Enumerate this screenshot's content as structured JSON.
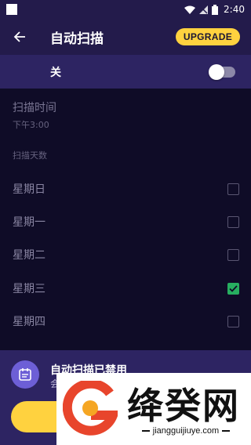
{
  "status": {
    "time": "2:40"
  },
  "header": {
    "title": "自动扫描",
    "upgrade_label": "UPGRADE"
  },
  "toggle": {
    "label": "关",
    "on": false
  },
  "scan_time": {
    "title": "扫描时间",
    "value": "下午3:00"
  },
  "days_section": {
    "label": "扫描天数",
    "days": [
      {
        "label": "星期日",
        "checked": false
      },
      {
        "label": "星期一",
        "checked": false
      },
      {
        "label": "星期二",
        "checked": false
      },
      {
        "label": "星期三",
        "checked": true
      },
      {
        "label": "星期四",
        "checked": false
      }
    ]
  },
  "bottom_card": {
    "title": "自动扫描已禁用",
    "subtitle": "会"
  },
  "watermark": {
    "brand": "绛癸网",
    "url": "jiangguijiuye.com"
  },
  "colors": {
    "background": "#0f0c27",
    "header": "#231b4b",
    "toggle_row": "#2d2462",
    "accent_yellow": "#ffd23f",
    "check_green": "#27ae60",
    "card_icon": "#6d5fd6"
  }
}
